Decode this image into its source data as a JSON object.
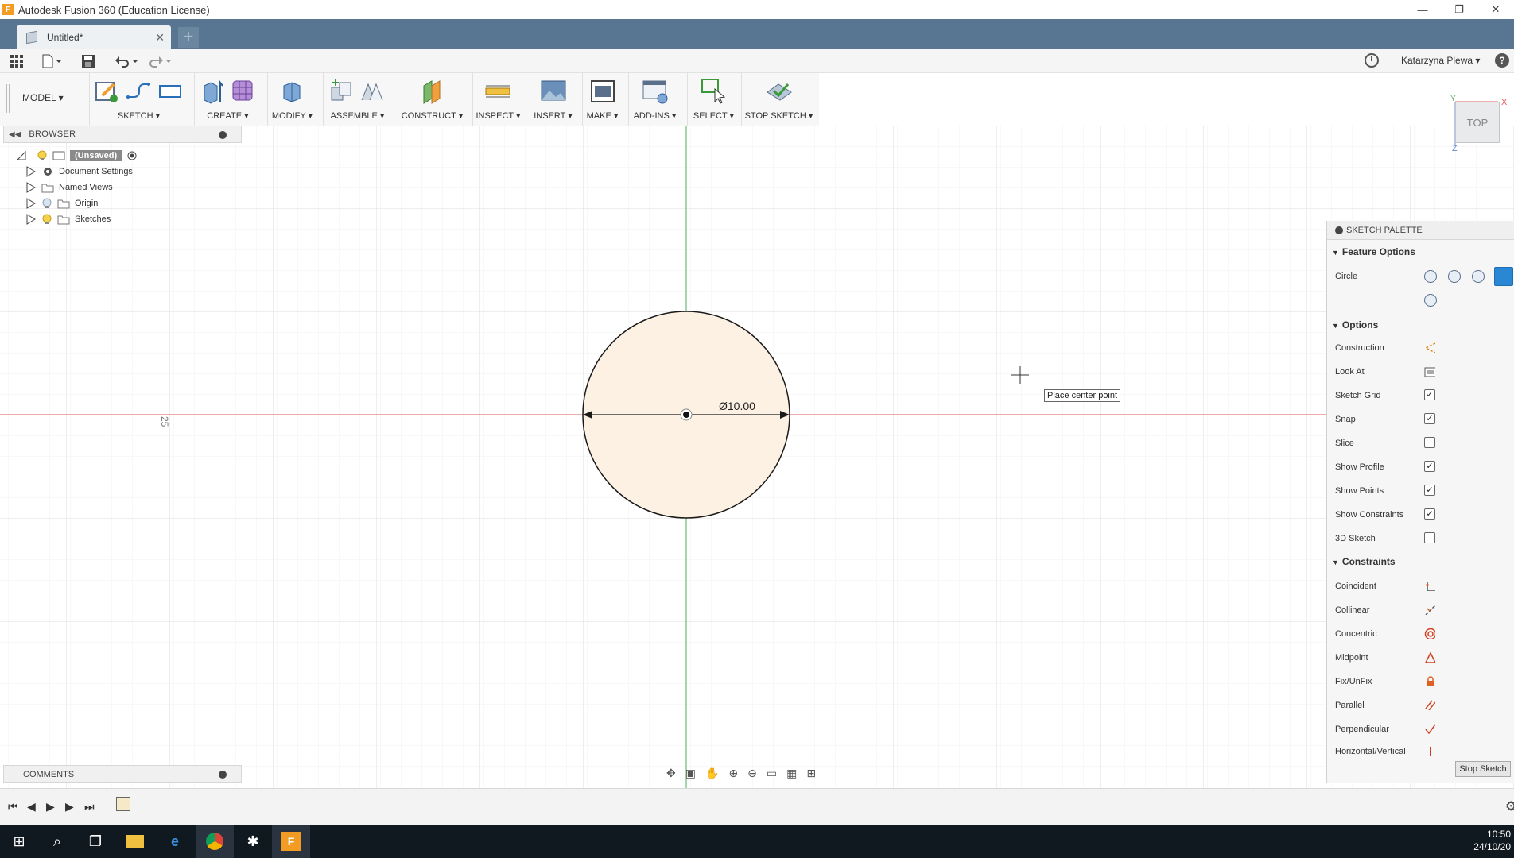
{
  "window": {
    "title": "Autodesk Fusion 360 (Education License)",
    "logo_letter": "F",
    "controls": [
      "—",
      "❐",
      "✕"
    ]
  },
  "tabs": {
    "doc_name": "Untitled*",
    "close": "✕",
    "new_tab": "+"
  },
  "quickbar": {
    "user_name": "Katarzyna Plewa",
    "help": "?"
  },
  "toolbar": {
    "workspace": "MODEL",
    "groups": [
      {
        "label": "SKETCH"
      },
      {
        "label": "CREATE"
      },
      {
        "label": "MODIFY"
      },
      {
        "label": "ASSEMBLE"
      },
      {
        "label": "CONSTRUCT"
      },
      {
        "label": "INSPECT"
      },
      {
        "label": "INSERT"
      },
      {
        "label": "MAKE"
      },
      {
        "label": "ADD-INS"
      },
      {
        "label": "SELECT"
      },
      {
        "label": "STOP SKETCH"
      }
    ]
  },
  "browser": {
    "header": "BROWSER",
    "root": "(Unsaved)",
    "items": [
      "Document Settings",
      "Named Views",
      "Origin",
      "Sketches"
    ]
  },
  "comments": {
    "header": "COMMENTS"
  },
  "canvas": {
    "dimension_label": "Ø10.00",
    "ruler_label": "25",
    "tooltip": "Place center point",
    "colors": {
      "x_axis": "#e05a5a",
      "y_axis": "#4caf50",
      "circle_fill": "#fdf1e4"
    }
  },
  "viewcube": {
    "face": "TOP",
    "axis_x": "X",
    "axis_y": "Y",
    "axis_z": "Z"
  },
  "palette": {
    "title": "SKETCH PALETTE",
    "feature_options": "Feature Options",
    "circle_label": "Circle",
    "options_header": "Options",
    "options": [
      {
        "label": "Construction",
        "type": "icon"
      },
      {
        "label": "Look At",
        "type": "icon"
      },
      {
        "label": "Sketch Grid",
        "checked": true
      },
      {
        "label": "Snap",
        "checked": true
      },
      {
        "label": "Slice",
        "checked": false
      },
      {
        "label": "Show Profile",
        "checked": true
      },
      {
        "label": "Show Points",
        "checked": true
      },
      {
        "label": "Show Constraints",
        "checked": true
      },
      {
        "label": "3D Sketch",
        "checked": false
      }
    ],
    "constraints_header": "Constraints",
    "constraints": [
      "Coincident",
      "Collinear",
      "Concentric",
      "Midpoint",
      "Fix/UnFix",
      "Parallel",
      "Perpendicular",
      "Horizontal/Vertical"
    ],
    "stop_sketch": "Stop Sketch"
  },
  "taskbar": {
    "time": "10:50",
    "date": "24/10/20"
  }
}
